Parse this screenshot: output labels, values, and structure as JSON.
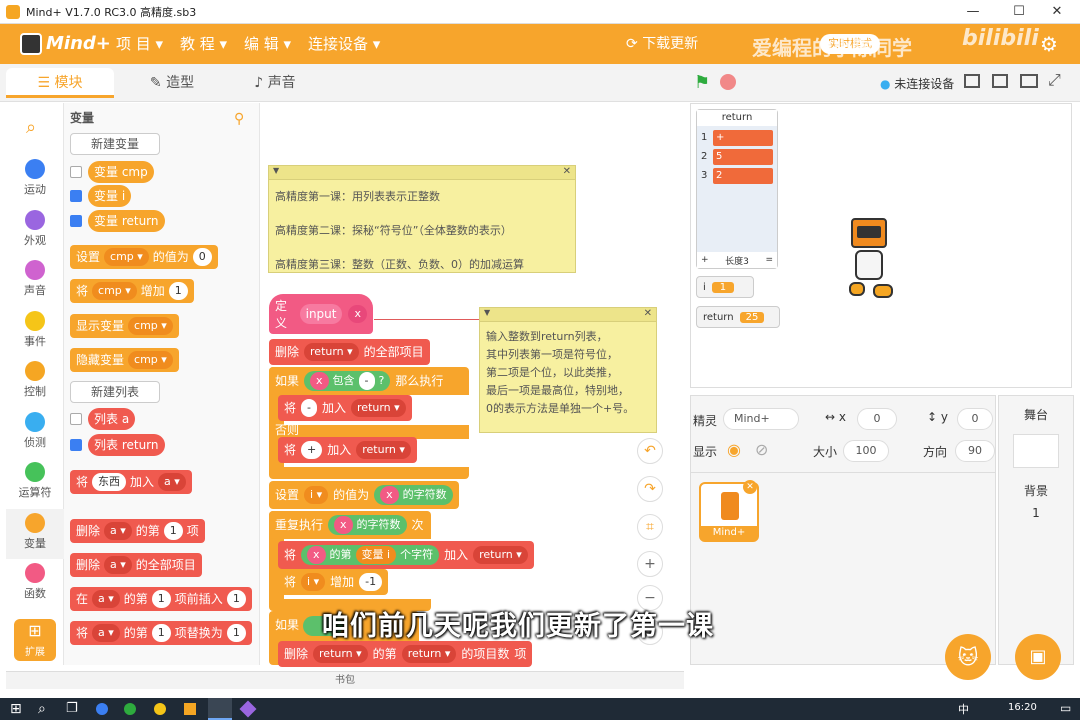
{
  "window": {
    "title": "Mind+ V1.7.0 RC3.0   高精度.sb3",
    "min": "—",
    "max": "☐",
    "close": "✕"
  },
  "menubar": {
    "brand": "Mind+",
    "items": [
      "项 目 ▾",
      "教 程 ▾",
      "编 辑 ▾",
      "连接设备 ▾"
    ],
    "download": "下载更新",
    "right_tag": "实时模式",
    "watermark": "爱编程的小陈同学",
    "watermark2": "bilibili"
  },
  "tabs": [
    "模块",
    "造型",
    "声音"
  ],
  "stagebar": {
    "connection": "未连接设备"
  },
  "categories": [
    {
      "label": "运动",
      "color": "#3b7ff2"
    },
    {
      "label": "外观",
      "color": "#9a66e0"
    },
    {
      "label": "声音",
      "color": "#cf63cf"
    },
    {
      "label": "事件",
      "color": "#f5c518"
    },
    {
      "label": "控制",
      "color": "#f5a623"
    },
    {
      "label": "侦测",
      "color": "#39aef0"
    },
    {
      "label": "运算符",
      "color": "#46c25a"
    },
    {
      "label": "变量",
      "color": "#f7a52c"
    },
    {
      "label": "函数",
      "color": "#f25a84"
    }
  ],
  "extension_label": "扩展",
  "palette": {
    "title": "变量",
    "new_var": "新建变量",
    "vars": [
      "变量 cmp",
      "变量 i",
      "变量 return"
    ],
    "set_block": {
      "a": "设置",
      "var": "cmp ▾",
      "b": "的值为",
      "val": "0"
    },
    "change_block": {
      "a": "将",
      "var": "cmp ▾",
      "b": "增加",
      "val": "1"
    },
    "show_block": {
      "a": "显示变量",
      "var": "cmp ▾"
    },
    "hide_block": {
      "a": "隐藏变量",
      "var": "cmp ▾"
    },
    "new_list": "新建列表",
    "lists": [
      "列表 a",
      "列表 return"
    ],
    "add_block": {
      "a": "将",
      "val": "东西",
      "b": "加入",
      "list": "a ▾"
    },
    "del_block": {
      "a": "删除",
      "list": "a ▾",
      "b": "的第",
      "val": "1",
      "c": "项"
    },
    "delall_block": {
      "a": "删除",
      "list": "a ▾",
      "b": "的全部项目"
    },
    "insert_block": {
      "a": "在",
      "list": "a ▾",
      "b": "的第",
      "val": "1",
      "c": "项前插入",
      "val2": "1"
    },
    "replace_block": {
      "a": "将",
      "list": "a ▾",
      "b": "的第",
      "val": "1",
      "c": "项替换为",
      "val2": "1"
    }
  },
  "notes": {
    "lesson_lines": [
      "高精度第一课：用列表表示正整数",
      "高精度第二课：探秘“符号位”（全体整数的表示）",
      "高精度第三课：整数（正数、负数、0）的加减运算"
    ],
    "desc_lines": [
      "输入整数到return列表，",
      "其中列表第一项是符号位，",
      "第二项是个位，以此类推，",
      "最后一项是最高位，特别地，",
      "0的表示方法是单独一个+号。"
    ]
  },
  "script": {
    "define": {
      "a": "定义",
      "b": "input",
      "c": "x"
    },
    "delall": {
      "a": "删除",
      "list": "return ▾",
      "b": "的全部项目"
    },
    "if1": {
      "a": "如果",
      "x": "x",
      "b": "包含",
      "c": "-",
      "q": "?",
      "d": "那么执行"
    },
    "add1": {
      "a": "将",
      "val": "-",
      "b": "加入",
      "list": "return ▾"
    },
    "else": "否则",
    "add2": {
      "a": "将",
      "val": "+",
      "b": "加入",
      "list": "return ▾"
    },
    "set": {
      "a": "设置",
      "var": "i ▾",
      "b": "的值为",
      "x": "x",
      "c": "的字符数"
    },
    "repeat": {
      "a": "重复执行",
      "x": "x",
      "b": "的字符数",
      "c": "次"
    },
    "add3": {
      "a": "将",
      "x": "x",
      "b": "的第",
      "var": "变量 i",
      "c": "个字符",
      "d": "加入",
      "list": "return ▾"
    },
    "change": {
      "a": "将",
      "var": "i ▾",
      "b": "增加",
      "val": "-1"
    },
    "if2": "如果",
    "delitem": {
      "a": "删除",
      "list": "return ▾",
      "b": "的第",
      "list2": "return ▾",
      "c": "的项目数",
      "d": "项"
    }
  },
  "monitor": {
    "title": "return",
    "items": [
      {
        "idx": "1",
        "val": "+"
      },
      {
        "idx": "2",
        "val": "5"
      },
      {
        "idx": "3",
        "val": "2"
      }
    ],
    "footer_plus": "+",
    "footer_len": "长度3",
    "footer_eq": "=",
    "i_label": "i",
    "i_val": "1",
    "ret_label": "return",
    "ret_val": "25"
  },
  "sprite_panel": {
    "sprite_label": "精灵",
    "sprite_name": "Mind+",
    "x_label": "x",
    "x_val": "0",
    "y_label": "y",
    "y_val": "0",
    "show_label": "显示",
    "size_label": "大小",
    "size_val": "100",
    "dir_label": "方向",
    "dir_val": "90",
    "thumb_label": "Mind+"
  },
  "stage_panel": {
    "title": "舞台",
    "bg_label": "背景",
    "bg_count": "1"
  },
  "bag": "书包",
  "subtitle": "咱们前几天呢我们更新了第一课",
  "taskbar": {
    "time": "16:20",
    "lang": "中"
  }
}
